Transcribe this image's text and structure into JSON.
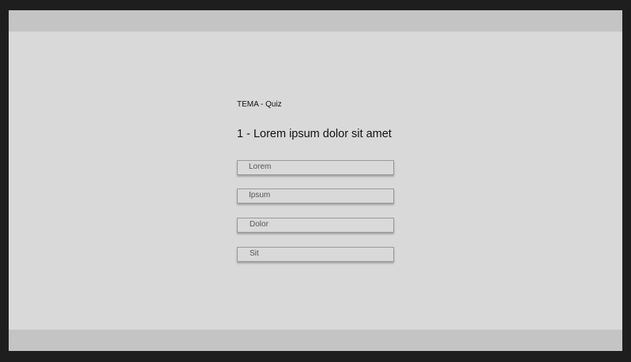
{
  "quiz": {
    "topic": "TEMA - Quiz",
    "question": "1 - Lorem ipsum dolor sit amet",
    "options": [
      {
        "label": "Lorem"
      },
      {
        "label": "Ipsum"
      },
      {
        "label": "Dolor"
      },
      {
        "label": "Sit"
      }
    ]
  },
  "colors": {
    "background": "#1e1e1e",
    "frame": "#d9d9d9",
    "bars": "#c4c4c4",
    "option_border": "#9a9a9a",
    "text": "#111111",
    "option_text": "#555555"
  }
}
